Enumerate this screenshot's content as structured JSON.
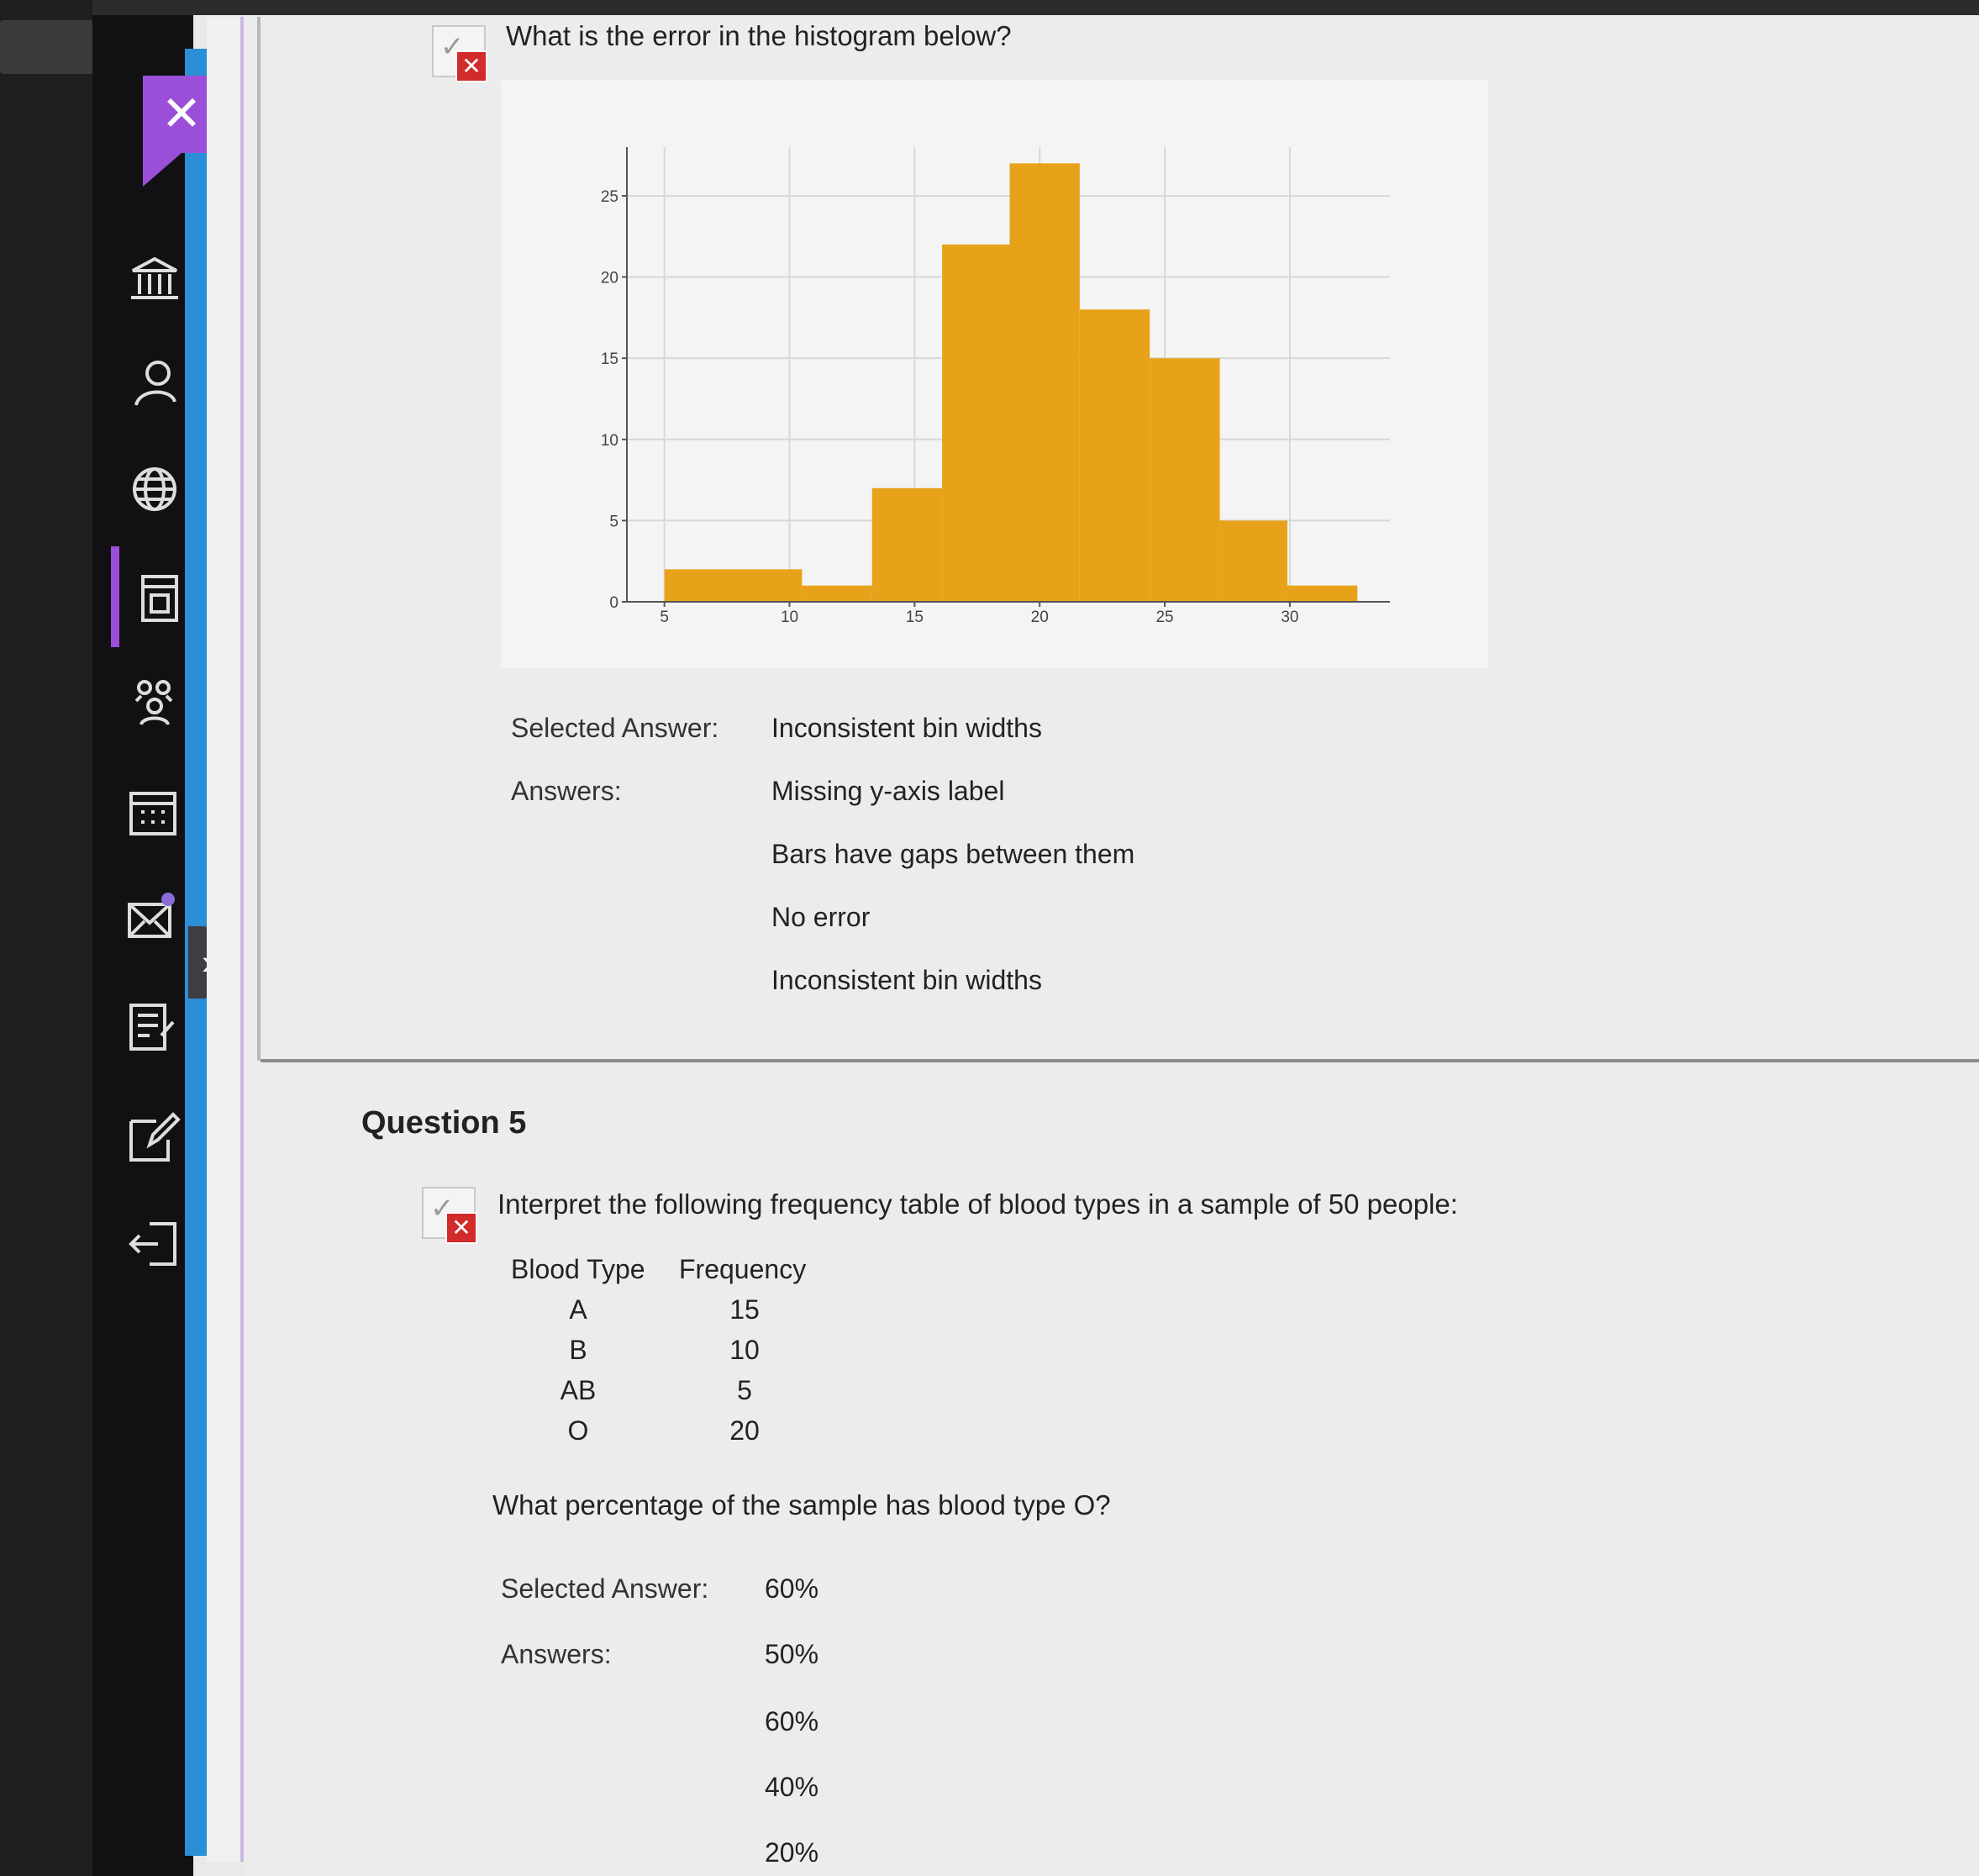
{
  "app": {
    "sidebar": {
      "close_symbol": "✕",
      "expand_symbol": "›",
      "icons": [
        "institution-icon",
        "user-icon",
        "globe-icon",
        "courses-icon",
        "groups-icon",
        "calendar-icon",
        "messages-icon",
        "grades-icon",
        "edit-icon",
        "sign-out-icon"
      ],
      "accent_color": "#9b4fd8",
      "edge_color": "#2a8fd6"
    }
  },
  "question4": {
    "prompt": "What is the error in the histogram below?",
    "status": "incorrect",
    "selected_label": "Selected Answer:",
    "selected_value": "Inconsistent bin widths",
    "answers_label": "Answers:",
    "answers": [
      "Missing y-axis label",
      "Bars have gaps between them",
      "No error",
      "Inconsistent bin widths"
    ]
  },
  "chart_data": {
    "type": "bar",
    "title": "",
    "xlabel": "",
    "ylabel": "",
    "xlim": [
      3.5,
      34
    ],
    "ylim": [
      0,
      28
    ],
    "xticks": [
      5,
      10,
      15,
      20,
      25,
      30
    ],
    "yticks": [
      0,
      5,
      10,
      15,
      20,
      25
    ],
    "grid": true,
    "color": "#e8a21a",
    "bins": [
      {
        "x0": 5,
        "x1": 10.5,
        "value": 2
      },
      {
        "x0": 10.5,
        "x1": 13.3,
        "value": 1
      },
      {
        "x0": 13.3,
        "x1": 16.1,
        "value": 7
      },
      {
        "x0": 16.1,
        "x1": 18.8,
        "value": 22
      },
      {
        "x0": 18.8,
        "x1": 21.6,
        "value": 27
      },
      {
        "x0": 21.6,
        "x1": 24.4,
        "value": 18
      },
      {
        "x0": 24.4,
        "x1": 27.2,
        "value": 15
      },
      {
        "x0": 27.2,
        "x1": 29.9,
        "value": 5
      },
      {
        "x0": 29.9,
        "x1": 32.7,
        "value": 1
      }
    ]
  },
  "question5": {
    "title": "Question 5",
    "status": "incorrect",
    "prompt": "Interpret the following frequency table of blood types in a sample of 50 people:",
    "table": {
      "headers": [
        "Blood Type",
        "Frequency"
      ],
      "rows": [
        [
          "A",
          "15"
        ],
        [
          "B",
          "10"
        ],
        [
          "AB",
          "5"
        ],
        [
          "O",
          "20"
        ]
      ]
    },
    "sub_prompt": "What percentage of the sample has blood type O?",
    "selected_label": "Selected Answer:",
    "selected_value": "60%",
    "answers_label": "Answers:",
    "answers": [
      "50%",
      "60%",
      "40%",
      "20%"
    ]
  }
}
